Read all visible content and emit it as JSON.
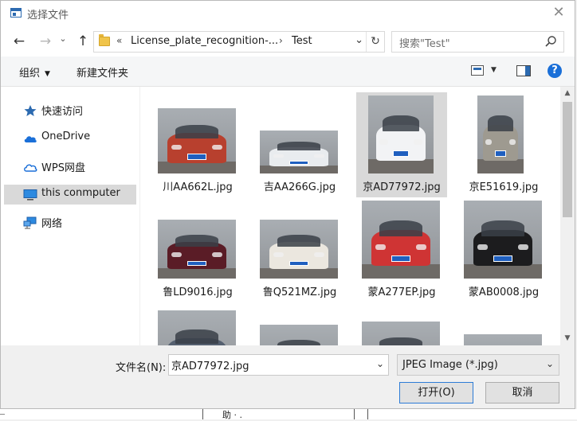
{
  "window": {
    "title": "选择文件"
  },
  "nav": {
    "back": "←",
    "forward": "→",
    "recent": "⌄",
    "up": "↑",
    "address_overflow": "«",
    "path": [
      "License_plate_recognition-...",
      "Test"
    ],
    "path_separator": "›",
    "address_dropdown": "⌄",
    "refresh": "↻"
  },
  "search": {
    "placeholder": "搜索\"Test\""
  },
  "toolbar": {
    "organize_label": "组织",
    "new_folder_label": "新建文件夹",
    "help": "?"
  },
  "sidebar": {
    "items": [
      {
        "label": "快速访问",
        "icon": "star-icon",
        "selected": false
      },
      {
        "label": "OneDrive",
        "icon": "cloud-icon",
        "selected": false
      },
      {
        "label": "WPS网盘",
        "icon": "cloud-outline-icon",
        "selected": false
      },
      {
        "label": "this conmputer",
        "icon": "computer-icon",
        "selected": true
      },
      {
        "label": "网络",
        "icon": "network-icon",
        "selected": false
      }
    ]
  },
  "files": [
    {
      "name": "川AA662L.jpg",
      "selected": false,
      "color": "#b8402e"
    },
    {
      "name": "吉AA266G.jpg",
      "selected": false,
      "color": "#e9ecef"
    },
    {
      "name": "京AD77972.jpg",
      "selected": true,
      "color": "#f2f3f5"
    },
    {
      "name": "京E51619.jpg",
      "selected": false,
      "color": "#9e9a90"
    },
    {
      "name": "鲁LD9016.jpg",
      "selected": false,
      "color": "#5a1c26"
    },
    {
      "name": "鲁Q521MZ.jpg",
      "selected": false,
      "color": "#ebe7df"
    },
    {
      "name": "蒙A277EP.jpg",
      "selected": false,
      "color": "#cf3434"
    },
    {
      "name": "蒙AB0008.jpg",
      "selected": false,
      "color": "#1c1c1e"
    },
    {
      "name": "",
      "selected": false,
      "color": "#556070"
    },
    {
      "name": "",
      "selected": false,
      "color": "#8a8a8e"
    },
    {
      "name": "",
      "selected": false,
      "color": "#6a6060"
    },
    {
      "name": "",
      "selected": false,
      "color": "#7a3530"
    }
  ],
  "footer": {
    "filename_label": "文件名(N):",
    "filename_value": "京AD77972.jpg",
    "filetype_value": "JPEG Image (*.jpg)",
    "open_label": "打开(O)",
    "cancel_label": "取消"
  },
  "background": {
    "text": "助  · ."
  }
}
